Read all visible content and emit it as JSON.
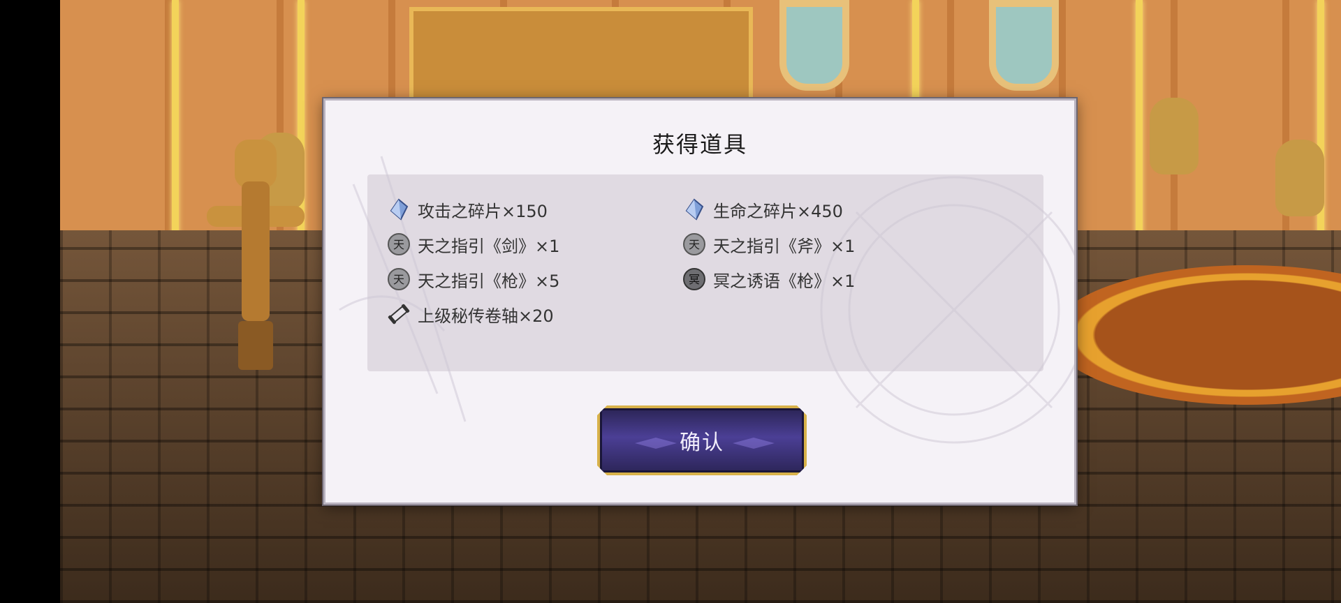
{
  "dialog": {
    "title": "获得道具",
    "items": [
      {
        "icon": "blue-crystal-icon",
        "label": "攻击之碎片×150"
      },
      {
        "icon": "blue-crystal-icon",
        "label": "生命之碎片×450"
      },
      {
        "icon": "heaven-seal-icon",
        "label": "天之指引《剑》×1"
      },
      {
        "icon": "heaven-seal-icon",
        "label": "天之指引《斧》×1"
      },
      {
        "icon": "heaven-seal-icon",
        "label": "天之指引《枪》×5"
      },
      {
        "icon": "underworld-seal-icon",
        "label": "冥之诱语《枪》×1"
      },
      {
        "icon": "scroll-icon",
        "label": "上级秘传卷轴×20"
      }
    ],
    "confirm_label": "确认"
  },
  "colors": {
    "dialog_bg": "#f5f2f7",
    "button_bg": "#4b3f95",
    "button_border": "#d8b24a"
  }
}
